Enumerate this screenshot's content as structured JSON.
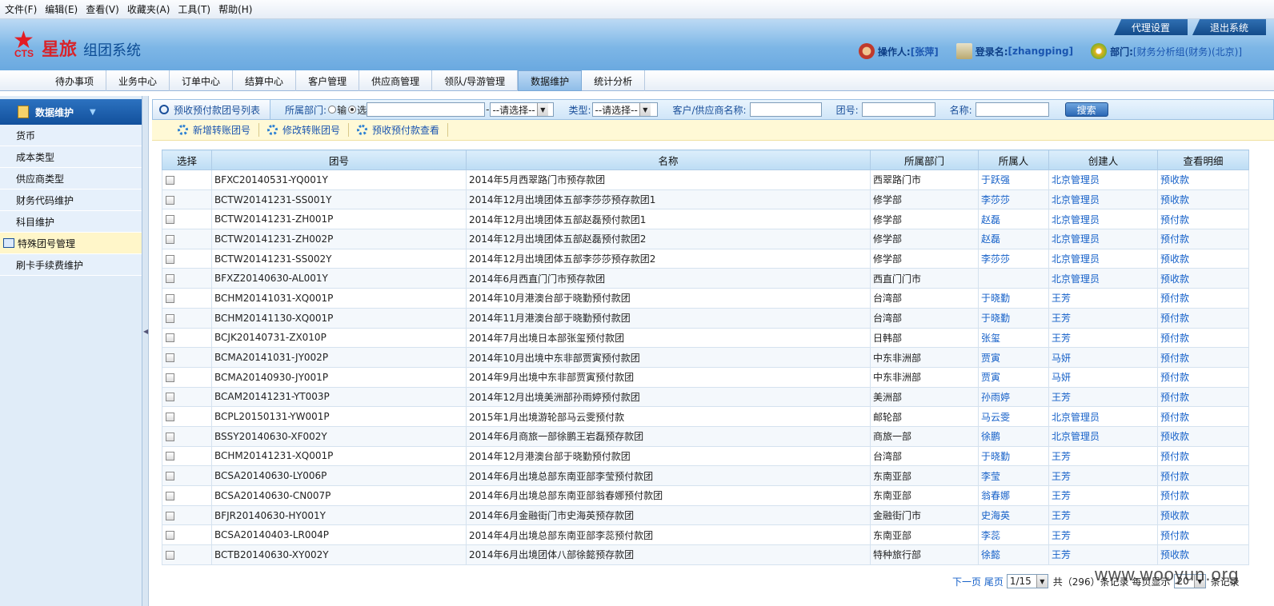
{
  "menubar": [
    "文件(F)",
    "编辑(E)",
    "查看(V)",
    "收藏夹(A)",
    "工具(T)",
    "帮助(H)"
  ],
  "header": {
    "logo_text": "CTS",
    "brand_red": "星旅",
    "brand_blue": "组团系统",
    "top_buttons": [
      "代理设置",
      "退出系统"
    ],
    "operator_label": "操作人:",
    "operator_value": "[张萍]",
    "login_label": "登录名:",
    "login_value": "[zhangping]",
    "dept_label": "部门:",
    "dept_value": "[财务分析组(财务)(北京)]"
  },
  "nav": [
    "待办事项",
    "业务中心",
    "订单中心",
    "结算中心",
    "客户管理",
    "供应商管理",
    "领队/导游管理",
    "数据维护",
    "统计分析"
  ],
  "nav_active": "数据维护",
  "sidebar": {
    "title": "数据维护",
    "items": [
      "货币",
      "成本类型",
      "供应商类型",
      "财务代码维护",
      "科目维护",
      "特殊团号管理",
      "刷卡手续费维护"
    ],
    "active": "特殊团号管理"
  },
  "toolbar": {
    "title": "预收预付款团号列表",
    "dept_label": "所属部门:",
    "radio1": "输",
    "radio2": "选",
    "dept_select": "--请选择--",
    "type_label": "类型:",
    "type_select": "--请选择--",
    "customer_label": "客户/供应商名称:",
    "group_label": "团号:",
    "name_label": "名称:",
    "search_btn": "搜索"
  },
  "actions": [
    "新增转账团号",
    "修改转账团号",
    "预收预付款查看"
  ],
  "table": {
    "headers": [
      "选择",
      "团号",
      "名称",
      "所属部门",
      "所属人",
      "创建人",
      "查看明细"
    ],
    "rows": [
      [
        "BFXC20140531-YQ001Y",
        "2014年5月西翠路门市预存款团",
        "西翠路门市",
        "于跃强",
        "北京管理员",
        "预收款"
      ],
      [
        "BCTW20141231-SS001Y",
        "2014年12月出境团体五部李莎莎预存款团1",
        "修学部",
        "李莎莎",
        "北京管理员",
        "预收款"
      ],
      [
        "BCTW20141231-ZH001P",
        "2014年12月出境团体五部赵磊预付款团1",
        "修学部",
        "赵磊",
        "北京管理员",
        "预付款"
      ],
      [
        "BCTW20141231-ZH002P",
        "2014年12月出境团体五部赵磊预付款团2",
        "修学部",
        "赵磊",
        "北京管理员",
        "预付款"
      ],
      [
        "BCTW20141231-SS002Y",
        "2014年12月出境团体五部李莎莎预存款团2",
        "修学部",
        "李莎莎",
        "北京管理员",
        "预收款"
      ],
      [
        "BFXZ20140630-AL001Y",
        "2014年6月西直门门市预存款团",
        "西直门门市",
        "",
        "北京管理员",
        "预收款"
      ],
      [
        "BCHM20141031-XQ001P",
        "2014年10月港澳台部于晓勤预付款团",
        "台湾部",
        "于晓勤",
        "王芳",
        "预付款"
      ],
      [
        "BCHM20141130-XQ001P",
        "2014年11月港澳台部于晓勤预付款团",
        "台湾部",
        "于晓勤",
        "王芳",
        "预付款"
      ],
      [
        "BCJK20140731-ZX010P",
        "2014年7月出境日本部张玺预付款团",
        "日韩部",
        "张玺",
        "王芳",
        "预付款"
      ],
      [
        "BCMA20141031-JY002P",
        "2014年10月出境中东非部贾寅预付款团",
        "中东非洲部",
        "贾寅",
        "马妍",
        "预付款"
      ],
      [
        "BCMA20140930-JY001P",
        "2014年9月出境中东非部贾寅预付款团",
        "中东非洲部",
        "贾寅",
        "马妍",
        "预付款"
      ],
      [
        "BCAM20141231-YT003P",
        "2014年12月出境美洲部孙雨婷预付款团",
        "美洲部",
        "孙雨婷",
        "王芳",
        "预付款"
      ],
      [
        "BCPL20150131-YW001P",
        "2015年1月出境游轮部马云雯预付款",
        "邮轮部",
        "马云雯",
        "北京管理员",
        "预付款"
      ],
      [
        "BSSY20140630-XF002Y",
        "2014年6月商旅一部徐鹏王岩磊预存款团",
        "商旅一部",
        "徐鹏",
        "北京管理员",
        "预收款"
      ],
      [
        "BCHM20141231-XQ001P",
        "2014年12月港澳台部于晓勤预付款团",
        "台湾部",
        "于晓勤",
        "王芳",
        "预付款"
      ],
      [
        "BCSA20140630-LY006P",
        "2014年6月出境总部东南亚部李莹预付款团",
        "东南亚部",
        "李莹",
        "王芳",
        "预付款"
      ],
      [
        "BCSA20140630-CN007P",
        "2014年6月出境总部东南亚部翁春娜预付款团",
        "东南亚部",
        "翁春娜",
        "王芳",
        "预付款"
      ],
      [
        "BFJR20140630-HY001Y",
        "2014年6月金融街门市史海英预存款团",
        "金融街门市",
        "史海英",
        "王芳",
        "预收款"
      ],
      [
        "BCSA20140403-LR004P",
        "2014年4月出境总部东南亚部李蕊预付款团",
        "东南亚部",
        "李蕊",
        "王芳",
        "预付款"
      ],
      [
        "BCTB20140630-XY002Y",
        "2014年6月出境团体八部徐懿预存款团",
        "特种旅行部",
        "徐懿",
        "王芳",
        "预收款"
      ]
    ]
  },
  "pager": {
    "links": "下一页 尾页",
    "page_select": "1/15",
    "total": "共（296）条记录 每页显示",
    "per_page": "20",
    "suffix": "条记录"
  },
  "watermark": "www.wooyun.org"
}
